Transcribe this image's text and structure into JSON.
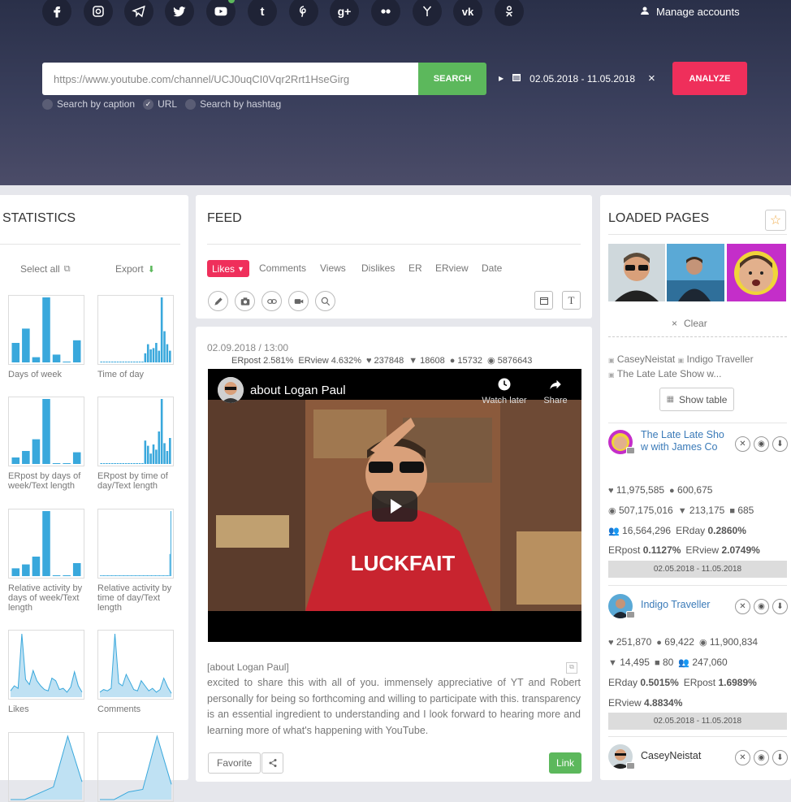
{
  "header": {
    "social_icons": [
      "facebook-icon",
      "instagram-icon",
      "telegram-icon",
      "twitter-icon",
      "youtube-icon",
      "tumblr-icon",
      "pinterest-icon",
      "googleplus-icon",
      "flickr-icon",
      "foursquare-icon",
      "vk-icon",
      "odnoklassniki-icon"
    ],
    "manage_accounts": "Manage accounts",
    "search": {
      "value": "https://www.youtube.com/channel/UCJ0uqCI0Vqr2Rrt1HseGirg",
      "button": "SEARCH"
    },
    "date_range": "02.05.2018 - 11.05.2018",
    "clear_symbol": "×",
    "analyze": "ANALYZE",
    "options": [
      {
        "label": "Search by caption",
        "checked": false
      },
      {
        "label": "URL",
        "checked": true
      },
      {
        "label": "Search by hashtag",
        "checked": false
      }
    ]
  },
  "statistics": {
    "title": "STATISTICS",
    "select_all": "Select all",
    "export": "Export",
    "charts": [
      {
        "label": "Days of week",
        "type": "bar",
        "values": [
          30,
          52,
          8,
          100,
          12,
          0,
          34
        ]
      },
      {
        "label": "Time of day",
        "type": "bar",
        "values": [
          1,
          1,
          1,
          1,
          1,
          1,
          1,
          1,
          1,
          1,
          1,
          1,
          1,
          1,
          1,
          1,
          14,
          28,
          20,
          22,
          30,
          18,
          100,
          48,
          28,
          18
        ]
      },
      {
        "label": "ERpost by days of week/Text length",
        "type": "bar",
        "values": [
          10,
          20,
          38,
          100,
          0,
          0,
          18
        ]
      },
      {
        "label": "ERpost by time of day/Text length",
        "type": "bar",
        "values": [
          1,
          1,
          1,
          1,
          1,
          1,
          1,
          1,
          1,
          1,
          1,
          1,
          1,
          1,
          1,
          1,
          36,
          28,
          16,
          30,
          22,
          50,
          100,
          32,
          20,
          40
        ]
      },
      {
        "label": "Relative activity by days of week/Text length",
        "type": "bar",
        "values": [
          12,
          18,
          30,
          100,
          0,
          0,
          20
        ]
      },
      {
        "label": "Relative activity by time of day/Text length",
        "type": "bar",
        "values": [
          1,
          1,
          1,
          1,
          1,
          1,
          1,
          1,
          1,
          1,
          1,
          1,
          1,
          1,
          1,
          1,
          1,
          1,
          1,
          1,
          1,
          1,
          1,
          1,
          1,
          1,
          1,
          1,
          1,
          1,
          1,
          1,
          1,
          1,
          1,
          1,
          1,
          1,
          1,
          1,
          1,
          1,
          1,
          1,
          1,
          1,
          1,
          1,
          1,
          1,
          1,
          1,
          1,
          1,
          1,
          1,
          1,
          1,
          1,
          1,
          1,
          1,
          1,
          1,
          1,
          1,
          1,
          1,
          34,
          100
        ]
      },
      {
        "label": "Likes",
        "type": "area",
        "values": [
          10,
          18,
          14,
          100,
          28,
          20,
          42,
          26,
          18,
          12,
          10,
          30,
          26,
          12,
          14,
          8,
          16,
          40,
          18,
          8
        ]
      },
      {
        "label": "Comments",
        "type": "area",
        "values": [
          8,
          12,
          10,
          14,
          100,
          22,
          18,
          36,
          24,
          12,
          10,
          26,
          18,
          10,
          14,
          8,
          12,
          30,
          16,
          6
        ]
      },
      {
        "label": "",
        "type": "area",
        "values": [
          0,
          0,
          10,
          20,
          100,
          28
        ]
      },
      {
        "label": "",
        "type": "area",
        "values": [
          0,
          0,
          12,
          16,
          100,
          24
        ]
      }
    ]
  },
  "feed": {
    "title": "FEED",
    "sort_tabs": [
      "Likes",
      "Comments",
      "Views",
      "Dislikes",
      "ER",
      "ERview",
      "Date"
    ],
    "active_tab": "Likes",
    "tool_icons": [
      "pencil-icon",
      "camera-icon",
      "link-icon",
      "video-icon",
      "search-icon"
    ],
    "text_toggle": "T",
    "post": {
      "date": "02.09.2018 / 13:00",
      "erpost_label": "ERpost",
      "erpost": "2.581%",
      "erview_label": "ERview",
      "erview": "4.632%",
      "likes": "237848",
      "dislikes": "18608",
      "comments": "15732",
      "views": "5876643",
      "video_title": "about Logan Paul",
      "watch_later": "Watch later",
      "share": "Share",
      "caption_title": "[about Logan Paul]",
      "caption": "excited to share this with all of you. immensely appreciative of YT and Robert personally for being so forthcoming and willing to participate with this. transparency is an essential ingredient to understanding and I look forward to hearing more and learning more of what's happening with YouTube.",
      "favorite": "Favorite",
      "link": "Link"
    }
  },
  "loaded_pages": {
    "title": "LOADED PAGES",
    "clear": "Clear",
    "tags": [
      "CaseyNeistat",
      "Indigo Traveller",
      "The Late Late Show w..."
    ],
    "show_table": "Show table",
    "pages": [
      {
        "name": "The Late Late Show with James Co",
        "likes": "11,975,585",
        "comments": "600,675",
        "views": "507,175,016",
        "dislikes": "213,175",
        "posts": "685",
        "followers": "16,564,296",
        "erday_label": "ERday",
        "erday": "0.2860%",
        "erpost_label": "ERpost",
        "erpost": "0.1127%",
        "erview_label": "ERview",
        "erview": "2.0749%",
        "dates": "02.05.2018 - 11.05.2018"
      },
      {
        "name": "Indigo Traveller",
        "likes": "251,870",
        "comments": "69,422",
        "views": "11,900,834",
        "dislikes": "14,495",
        "posts": "80",
        "followers": "247,060",
        "erday_label": "ERday",
        "erday": "0.5015%",
        "erpost_label": "ERpost",
        "erpost": "1.6989%",
        "erview_label": "ERview",
        "erview": "4.8834%",
        "dates": "02.05.2018 - 11.05.2018"
      },
      {
        "name": "CaseyNeistat"
      }
    ]
  },
  "colors": {
    "accent_red": "#ef2f5b",
    "accent_green": "#5cb85c",
    "chart_blue": "#39a8dc",
    "hero": "#2f344f"
  }
}
